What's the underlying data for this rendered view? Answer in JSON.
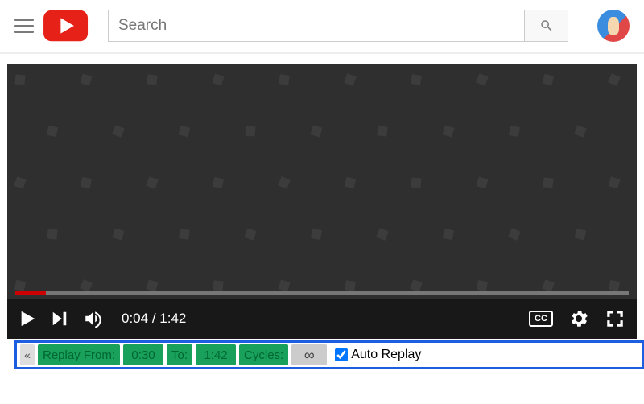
{
  "header": {
    "search_placeholder": "Search"
  },
  "player": {
    "time_current": "0:04",
    "time_sep": " / ",
    "time_total": "1:42",
    "cc_label": "CC"
  },
  "replay": {
    "collapse_glyph": "«",
    "from_label": "Replay From:",
    "from_value": "0:30",
    "to_label": "To:",
    "to_value": "1:42",
    "cycles_label": "Cycles:",
    "cycles_value": "∞",
    "auto_label": "Auto Replay",
    "auto_checked": true
  }
}
